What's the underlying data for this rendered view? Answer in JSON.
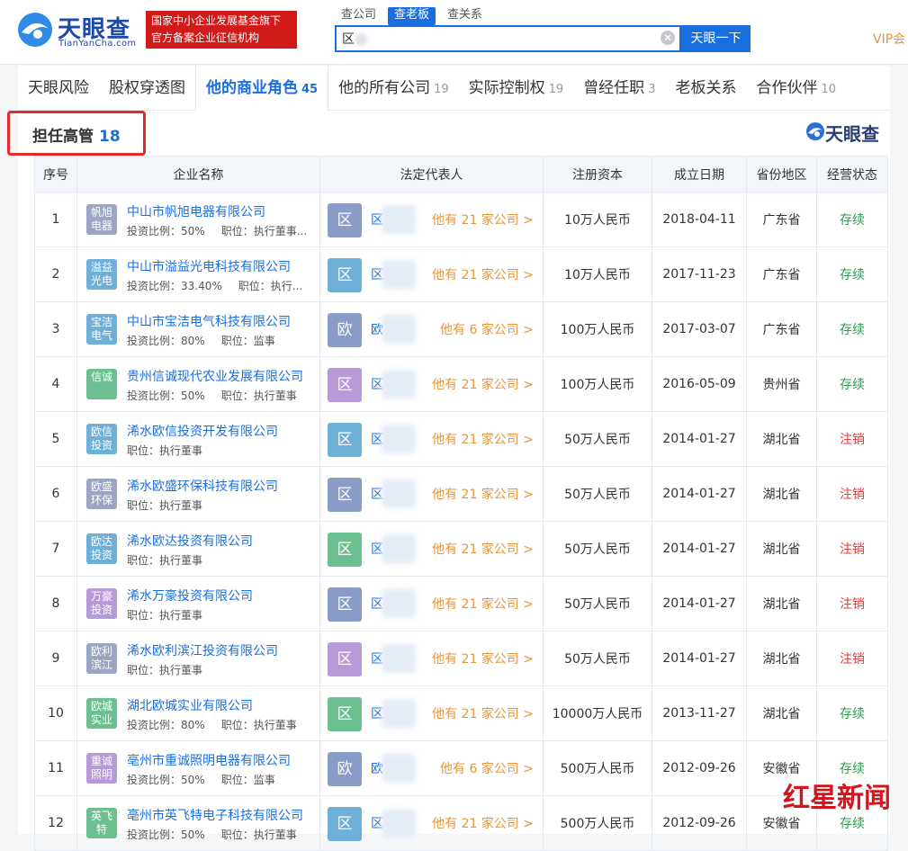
{
  "header": {
    "logo_text": "天眼查",
    "logo_sub": "TianYanCha.com",
    "notice_line1": "国家中小企业发展基金旗下",
    "notice_line2": "官方备案企业征信机构",
    "search_tabs": [
      "查公司",
      "查老板",
      "查关系"
    ],
    "search_value": "区",
    "search_button": "天眼一下",
    "vip": "VIP会"
  },
  "tabs": [
    {
      "label": "天眼风险",
      "count": ""
    },
    {
      "label": "股权穿透图",
      "count": ""
    },
    {
      "label": "他的商业角色",
      "count": "45"
    },
    {
      "label": "他的所有公司",
      "count": "19"
    },
    {
      "label": "实际控制权",
      "count": "19"
    },
    {
      "label": "曾经任职",
      "count": "3"
    },
    {
      "label": "老板关系",
      "count": ""
    },
    {
      "label": "合作伙伴",
      "count": "10"
    }
  ],
  "section": {
    "title": "担任高管",
    "count": "18",
    "brand": "天眼查"
  },
  "table": {
    "headers": [
      "序号",
      "企业名称",
      "法定代表人",
      "注册资本",
      "成立日期",
      "省份地区",
      "经营状态"
    ],
    "rows": [
      {
        "idx": "1",
        "logo": "帆旭\n电器",
        "logo_color": "#9aa6c4",
        "name": "中山市帆旭电器有限公司",
        "info1": "投资比例：50%",
        "info2": "职位：执行董事...",
        "rep": "区",
        "rep_name": "区",
        "rep_color": "#8a9cc8",
        "more": "他有 21 家公司 >",
        "capital": "10万人民币",
        "date": "2018-04-11",
        "province": "广东省",
        "status": "存续"
      },
      {
        "idx": "2",
        "logo": "溢益\n光电",
        "logo_color": "#6fb0d8",
        "name": "中山市溢益光电科技有限公司",
        "info1": "投资比例：33.40%",
        "info2": "职位：执行...",
        "rep": "区",
        "rep_name": "区",
        "rep_color": "#6fb0d8",
        "more": "他有 21 家公司 >",
        "capital": "10万人民币",
        "date": "2017-11-23",
        "province": "广东省",
        "status": "存续"
      },
      {
        "idx": "3",
        "logo": "宝洁\n电气",
        "logo_color": "#6fb0d8",
        "name": "中山市宝洁电气科技有限公司",
        "info1": "投资比例：80%",
        "info2": "职位：监事",
        "rep": "欧",
        "rep_name": "欧",
        "rep_color": "#8a9cc8",
        "more": "他有 6 家公司 >",
        "capital": "100万人民币",
        "date": "2017-03-07",
        "province": "广东省",
        "status": "存续"
      },
      {
        "idx": "4",
        "logo": "信诚",
        "logo_color": "#6cc08f",
        "name": "贵州信诚现代农业发展有限公司",
        "info1": "投资比例：50%",
        "info2": "职位：执行董事",
        "rep": "区",
        "rep_name": "区",
        "rep_color": "#b79ad8",
        "more": "他有 21 家公司 >",
        "capital": "100万人民币",
        "date": "2016-05-09",
        "province": "贵州省",
        "status": "存续"
      },
      {
        "idx": "5",
        "logo": "欧信\n投资",
        "logo_color": "#6fb0d8",
        "name": "浠水欧信投资开发有限公司",
        "info1": "职位：执行董事",
        "info2": "",
        "rep": "区",
        "rep_name": "区",
        "rep_color": "#6fb0d8",
        "more": "他有 21 家公司 >",
        "capital": "50万人民币",
        "date": "2014-01-27",
        "province": "湖北省",
        "status": "注销"
      },
      {
        "idx": "6",
        "logo": "欧盛\n环保",
        "logo_color": "#9aa6c4",
        "name": "浠水欧盛环保科技有限公司",
        "info1": "职位：执行董事",
        "info2": "",
        "rep": "区",
        "rep_name": "区",
        "rep_color": "#8a9cc8",
        "more": "他有 21 家公司 >",
        "capital": "50万人民币",
        "date": "2014-01-27",
        "province": "湖北省",
        "status": "注销"
      },
      {
        "idx": "7",
        "logo": "欧达\n投资",
        "logo_color": "#6fb0d8",
        "name": "浠水欧达投资有限公司",
        "info1": "职位：执行董事",
        "info2": "",
        "rep": "区",
        "rep_name": "区",
        "rep_color": "#6cc08f",
        "more": "他有 21 家公司 >",
        "capital": "50万人民币",
        "date": "2014-01-27",
        "province": "湖北省",
        "status": "注销"
      },
      {
        "idx": "8",
        "logo": "万豪\n投资",
        "logo_color": "#b79ad8",
        "name": "浠水万豪投资有限公司",
        "info1": "职位：执行董事",
        "info2": "",
        "rep": "区",
        "rep_name": "区",
        "rep_color": "#8a9cc8",
        "more": "他有 21 家公司 >",
        "capital": "50万人民币",
        "date": "2014-01-27",
        "province": "湖北省",
        "status": "注销"
      },
      {
        "idx": "9",
        "logo": "欧利\n滨江",
        "logo_color": "#9aa6c4",
        "name": "浠水欧利滨江投资有限公司",
        "info1": "职位：执行董事",
        "info2": "",
        "rep": "区",
        "rep_name": "区",
        "rep_color": "#b79ad8",
        "more": "他有 21 家公司 >",
        "capital": "50万人民币",
        "date": "2014-01-27",
        "province": "湖北省",
        "status": "注销"
      },
      {
        "idx": "10",
        "logo": "欧城\n实业",
        "logo_color": "#6cc08f",
        "name": "湖北欧城实业有限公司",
        "info1": "投资比例：80%",
        "info2": "职位：执行董事",
        "rep": "区",
        "rep_name": "区",
        "rep_color": "#6cc08f",
        "more": "他有 21 家公司 >",
        "capital": "10000万人民币",
        "date": "2013-11-27",
        "province": "湖北省",
        "status": "存续"
      },
      {
        "idx": "11",
        "logo": "重诚\n照明",
        "logo_color": "#b79ad8",
        "name": "亳州市重诚照明电器有限公司",
        "info1": "投资比例：50%",
        "info2": "职位：监事",
        "rep": "欧",
        "rep_name": "欧",
        "rep_color": "#8a9cc8",
        "more": "他有 6 家公司 >",
        "capital": "500万人民币",
        "date": "2012-09-26",
        "province": "安徽省",
        "status": "存续"
      },
      {
        "idx": "12",
        "logo": "英飞\n特",
        "logo_color": "#6cc08f",
        "name": "亳州市英飞特电子科技有限公司",
        "info1": "投资比例：50%",
        "info2": "职位：执行董事",
        "rep": "区",
        "rep_name": "区",
        "rep_color": "#6fb0d8",
        "more": "他有 21 家公司 >",
        "capital": "500万人民币",
        "date": "2012-09-26",
        "province": "安徽省",
        "status": "存续"
      }
    ]
  },
  "watermark": "红星新闻",
  "colors": {
    "accent": "#1a6fe0",
    "orange": "#e8953a",
    "active_status": "#2e9b4e",
    "cancelled_status": "#e23b3b"
  }
}
